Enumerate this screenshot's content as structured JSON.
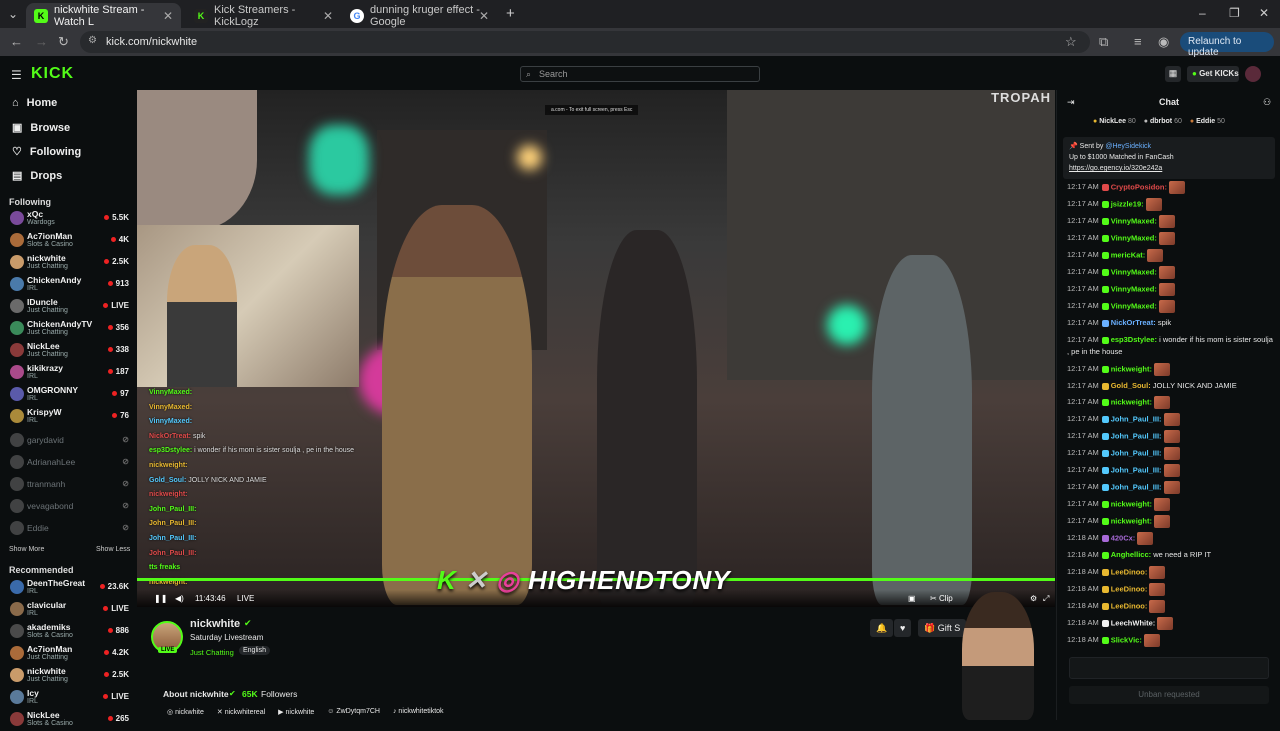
{
  "browser": {
    "tabs": [
      {
        "title": "nickwhite Stream - Watch L",
        "favicon": "K"
      },
      {
        "title": "Kick Streamers - KickLogz",
        "favicon": "K"
      },
      {
        "title": "dunning kruger effect - Google",
        "favicon": "G"
      }
    ],
    "url": "kick.com/nickwhite",
    "relaunch_label": "Relaunch to update"
  },
  "site": {
    "logo": "KICK",
    "search_placeholder": "Search",
    "get_kicks_label": "Get KICKs"
  },
  "sidebar": {
    "nav": [
      {
        "label": "Home",
        "icon": "home-icon"
      },
      {
        "label": "Browse",
        "icon": "browse-icon"
      },
      {
        "label": "Following",
        "icon": "heart-icon"
      },
      {
        "label": "Drops",
        "icon": "drops-icon"
      }
    ],
    "following_title": "Following",
    "following": [
      {
        "name": "xQc",
        "sub": "Wardogs",
        "viewers": "5.5K",
        "color": "#7a4a9a"
      },
      {
        "name": "Ac7ionMan",
        "sub": "Slots & Casino",
        "viewers": "4K",
        "color": "#aa6b3a"
      },
      {
        "name": "nickwhite",
        "sub": "Just Chatting",
        "viewers": "2.5K",
        "color": "#c99b6a"
      },
      {
        "name": "ChickenAndy",
        "sub": "IRL",
        "viewers": "913",
        "color": "#4a7aaa"
      },
      {
        "name": "IDuncle",
        "sub": "Just Chatting",
        "viewers": "LIVE",
        "color": "#6a6a6a"
      },
      {
        "name": "ChickenAndyTV",
        "sub": "Just Chatting",
        "viewers": "356",
        "color": "#3a8a5a"
      },
      {
        "name": "NickLee",
        "sub": "Just Chatting",
        "viewers": "338",
        "color": "#8a3a3a"
      },
      {
        "name": "kikikrazy",
        "sub": "IRL",
        "viewers": "187",
        "color": "#aa4a8a"
      },
      {
        "name": "OMGRONNY",
        "sub": "IRL",
        "viewers": "97",
        "color": "#5a5aaa"
      },
      {
        "name": "KrispyW",
        "sub": "IRL",
        "viewers": "76",
        "color": "#aa8a3a"
      }
    ],
    "offline": [
      "garydavid",
      "AdrianahLee",
      "ttranmanh",
      "vevagabond",
      "Eddie"
    ],
    "show_more": "Show More",
    "show_less": "Show Less",
    "recommended_title": "Recommended",
    "recommended": [
      {
        "name": "DeenTheGreat",
        "sub": "IRL",
        "viewers": "23.6K",
        "color": "#3a6aaa"
      },
      {
        "name": "clavicular",
        "sub": "IRL",
        "viewers": "LIVE",
        "color": "#8a6a4a"
      },
      {
        "name": "akademiks",
        "sub": "Slots & Casino",
        "viewers": "886",
        "color": "#4a4a4a"
      },
      {
        "name": "Ac7ionMan",
        "sub": "Just Chatting",
        "viewers": "4.2K",
        "color": "#aa6b3a"
      },
      {
        "name": "nickwhite",
        "sub": "Just Chatting",
        "viewers": "2.5K",
        "color": "#c99b6a"
      },
      {
        "name": "Icy",
        "sub": "IRL",
        "viewers": "LIVE",
        "color": "#5a7a9a"
      },
      {
        "name": "NickLee",
        "sub": "Slots & Casino",
        "viewers": "265",
        "color": "#8a3a3a"
      }
    ]
  },
  "video": {
    "watermark": "TROPAH",
    "banner": "HIGHENDTONY",
    "top_text": "a.com - To exit full screen, press Esc",
    "time": "11:43:46",
    "live": "LIVE",
    "clip_label": "Clip",
    "overlay_chat": [
      {
        "user": "VinnyMaxed:",
        "text": ""
      },
      {
        "user": "VinnyMaxed:",
        "text": ""
      },
      {
        "user": "VinnyMaxed:",
        "text": ""
      },
      {
        "user": "NickOrTreat:",
        "text": "spik"
      },
      {
        "user": "esp3Dstylee:",
        "text": "i wonder if his mom is sister soulja , pe in the house"
      },
      {
        "user": "nickweight:",
        "text": ""
      },
      {
        "user": "Gold_Soul:",
        "text": "JOLLY NICK AND JAMIE"
      },
      {
        "user": "nickweight:",
        "text": ""
      },
      {
        "user": "John_Paul_III:",
        "text": ""
      },
      {
        "user": "John_Paul_III:",
        "text": ""
      },
      {
        "user": "John_Paul_III:",
        "text": ""
      },
      {
        "user": "John_Paul_III:",
        "text": ""
      },
      {
        "user": "tts freaks",
        "text": ""
      },
      {
        "user": "nickweight:",
        "text": ""
      }
    ]
  },
  "channel": {
    "name": "nickwhite",
    "title": "Saturday Livestream",
    "category": "Just Chatting",
    "language": "English",
    "live_badge": "LIVE",
    "gift_label": "Gift S",
    "about_label": "About nickwhite",
    "followers_count": "65K",
    "followers_label": "Followers",
    "socials": [
      "nickwhite",
      "nickwhitereal",
      "nickwhite",
      "ZwDytqm7CH",
      "nickwhitetiktok"
    ]
  },
  "chat": {
    "title": "Chat",
    "top_gifters": [
      {
        "name": "NickLee",
        "count": "80"
      },
      {
        "name": "dbrbot",
        "count": "60"
      },
      {
        "name": "Eddie",
        "count": "50"
      }
    ],
    "pinned": {
      "sent_by": "Sent by",
      "sender": "@HeySidekick",
      "text": "Up to $1000 Matched in FanCash",
      "link": "https://go.egency.io/320e242a"
    },
    "messages": [
      {
        "time": "12:17 AM",
        "user": "CryptoPosidon:",
        "text": "",
        "color": "#e04a4a"
      },
      {
        "time": "12:17 AM",
        "user": "jsizzle19:",
        "text": "",
        "color": "#53fc18"
      },
      {
        "time": "12:17 AM",
        "user": "VinnyMaxed:",
        "text": "",
        "color": "#53fc18"
      },
      {
        "time": "12:17 AM",
        "user": "VinnyMaxed:",
        "text": "",
        "color": "#53fc18"
      },
      {
        "time": "12:17 AM",
        "user": "mericKat:",
        "text": "",
        "color": "#53fc18"
      },
      {
        "time": "12:17 AM",
        "user": "VinnyMaxed:",
        "text": "",
        "color": "#53fc18"
      },
      {
        "time": "12:17 AM",
        "user": "VinnyMaxed:",
        "text": "",
        "color": "#53fc18"
      },
      {
        "time": "12:17 AM",
        "user": "VinnyMaxed:",
        "text": "",
        "color": "#53fc18"
      },
      {
        "time": "12:17 AM",
        "user": "NickOrTreat:",
        "text": "spik",
        "color": "#6ab0ff"
      },
      {
        "time": "12:17 AM",
        "user": "esp3Dstylee:",
        "text": "i wonder if his mom is sister soulja , pe in the house",
        "color": "#53fc18"
      },
      {
        "time": "12:17 AM",
        "user": "nickweight:",
        "text": "",
        "color": "#53fc18"
      },
      {
        "time": "12:17 AM",
        "user": "Gold_Soul:",
        "text": "JOLLY NICK AND JAMIE",
        "color": "#e8b830"
      },
      {
        "time": "12:17 AM",
        "user": "nickweight:",
        "text": "",
        "color": "#53fc18"
      },
      {
        "time": "12:17 AM",
        "user": "John_Paul_III:",
        "text": "",
        "color": "#53c8fc"
      },
      {
        "time": "12:17 AM",
        "user": "John_Paul_III:",
        "text": "",
        "color": "#53c8fc"
      },
      {
        "time": "12:17 AM",
        "user": "John_Paul_III:",
        "text": "",
        "color": "#53c8fc"
      },
      {
        "time": "12:17 AM",
        "user": "John_Paul_III:",
        "text": "",
        "color": "#53c8fc"
      },
      {
        "time": "12:17 AM",
        "user": "John_Paul_III:",
        "text": "",
        "color": "#53c8fc"
      },
      {
        "time": "12:17 AM",
        "user": "nickweight:",
        "text": "",
        "color": "#53fc18"
      },
      {
        "time": "12:17 AM",
        "user": "nickweight:",
        "text": "",
        "color": "#53fc18"
      },
      {
        "time": "12:18 AM",
        "user": "420Cx:",
        "text": "",
        "color": "#a86ad8"
      },
      {
        "time": "12:18 AM",
        "user": "Anghellicc:",
        "text": "we need a RIP IT",
        "color": "#53fc18"
      },
      {
        "time": "12:18 AM",
        "user": "LeeDinoo:",
        "text": "",
        "color": "#e8b830"
      },
      {
        "time": "12:18 AM",
        "user": "LeeDinoo:",
        "text": "",
        "color": "#e8b830"
      },
      {
        "time": "12:18 AM",
        "user": "LeeDinoo:",
        "text": "",
        "color": "#e8b830"
      },
      {
        "time": "12:18 AM",
        "user": "LeechWhite:",
        "text": "",
        "color": "#f0f0f0"
      },
      {
        "time": "12:18 AM",
        "user": "SlickVic:",
        "text": "",
        "color": "#53fc18"
      }
    ],
    "unban_label": "Unban requested"
  }
}
